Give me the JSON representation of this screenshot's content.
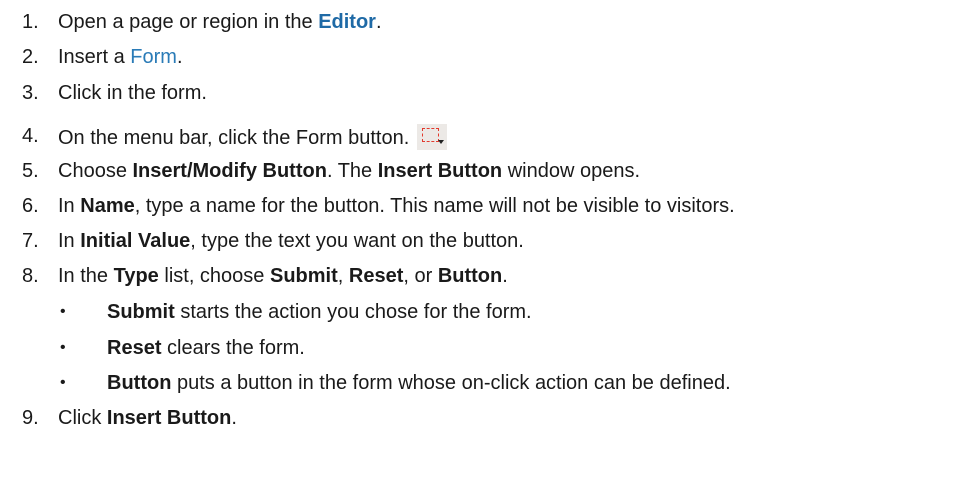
{
  "steps": [
    {
      "num": "1.",
      "pre": "Open a page or region in the ",
      "link": "Editor",
      "post": "."
    },
    {
      "num": "2.",
      "pre": "Insert a ",
      "link": "Form",
      "post": "."
    },
    {
      "num": "3.",
      "text": "Click in the form."
    },
    {
      "num": "4.",
      "text": "On the menu bar, click the Form button.",
      "icon": "form-dropdown-icon"
    },
    {
      "num": "5.",
      "pre": "Choose ",
      "b1": "Insert/Modify Button",
      "mid": ". The ",
      "b2": "Insert Button",
      "post": " window opens."
    },
    {
      "num": "6.",
      "pre": "In ",
      "b1": "Name",
      "post": ", type a name for the button. This name will not be visible to visitors."
    },
    {
      "num": "7.",
      "pre": "In ",
      "b1": "Initial Value",
      "post": ", type the text you want on the button."
    },
    {
      "num": "8.",
      "pre": "In the ",
      "b1": "Type",
      "mid1": " list, choose ",
      "b2": "Submit",
      "sep1": ", ",
      "b3": "Reset",
      "mid2": ", or ",
      "b4": "Button",
      "post": "."
    },
    {
      "num": "9.",
      "pre": "Click ",
      "b1": "Insert Button",
      "post": "."
    }
  ],
  "bullets": [
    {
      "bullet": "•",
      "b": "Submit",
      "text": " starts the action you chose for the form."
    },
    {
      "bullet": "•",
      "b": "Reset",
      "text": " clears the form."
    },
    {
      "bullet": "•",
      "b": "Button",
      "text": " puts a button in the form whose on-click action can be defined."
    }
  ]
}
